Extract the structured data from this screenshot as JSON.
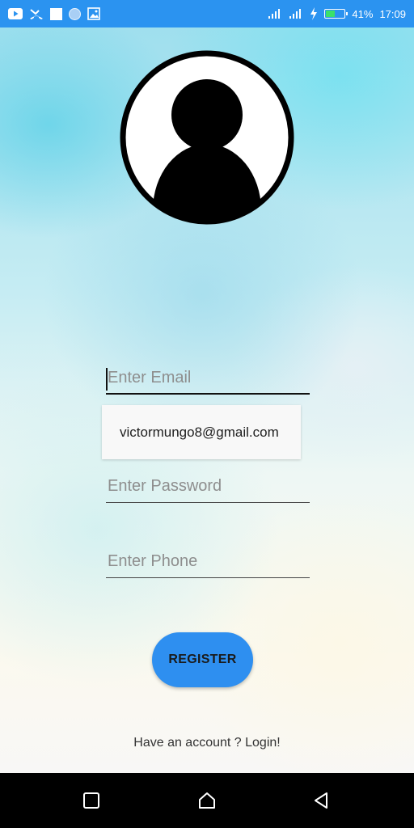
{
  "status_bar": {
    "battery_percent": "41%",
    "time": "17:09",
    "battery_level": 0.41,
    "icons": [
      "youtube-icon",
      "missed-call-icon",
      "square-notification-icon",
      "circle-notification-icon",
      "image-icon",
      "signal-icon",
      "signal-icon",
      "charging-icon",
      "battery-icon"
    ]
  },
  "form": {
    "email_placeholder": "Enter Email",
    "email_value": "",
    "autocomplete_suggestion": "victormungo8@gmail.com",
    "password_placeholder": "Enter Password",
    "password_value": "",
    "phone_placeholder": "Enter Phone",
    "phone_value": "",
    "register_label": "REGISTER",
    "login_link": "Have an account ? Login!"
  },
  "nav_bar": {
    "icons": [
      "back-square-icon",
      "home-icon",
      "recent-triangle-icon"
    ]
  },
  "colors": {
    "status_bar": "#2b93f0",
    "accent": "#2e8ff0",
    "nav_bar": "#000000"
  }
}
